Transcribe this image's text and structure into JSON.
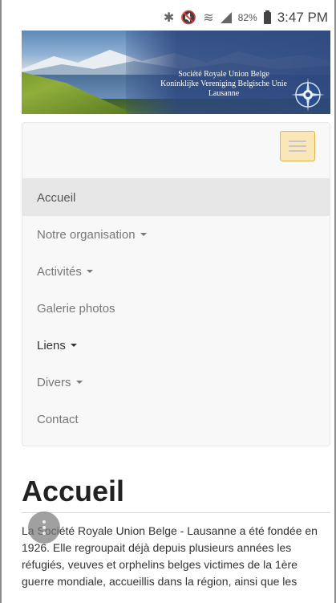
{
  "status_bar": {
    "icons": [
      "bluetooth-icon",
      "mute-icon",
      "wifi-icon",
      "signal-icon"
    ],
    "battery": "82%",
    "time": "3:47 PM"
  },
  "banner": {
    "line1": "Société Royale Union Belge",
    "line2": "Koninklijke Vereniging Belgische Unie",
    "line3": "Lausanne"
  },
  "nav": {
    "items": [
      {
        "label": "Accueil",
        "has_dropdown": false
      },
      {
        "label": "Notre organisation",
        "has_dropdown": true
      },
      {
        "label": "Activités",
        "has_dropdown": true
      },
      {
        "label": "Galerie photos",
        "has_dropdown": false
      },
      {
        "label": "Liens",
        "has_dropdown": true
      },
      {
        "label": "Divers",
        "has_dropdown": true
      },
      {
        "label": "Contact",
        "has_dropdown": false
      }
    ]
  },
  "content": {
    "heading": "Accueil",
    "paragraph": "La Société Royale Union Belge - Lausanne a été fondée en 1926. Elle regroupait déjà depuis plusieurs années les réfugiés, veuves et orphelins belges victimes de la 1ère guerre mondiale, accueillis dans la région, ainsi que les"
  },
  "colors": {
    "toggle_border": "#e0b252",
    "toggle_bg": "#fbe6b8",
    "active_item_bg": "#e7e7e7"
  }
}
